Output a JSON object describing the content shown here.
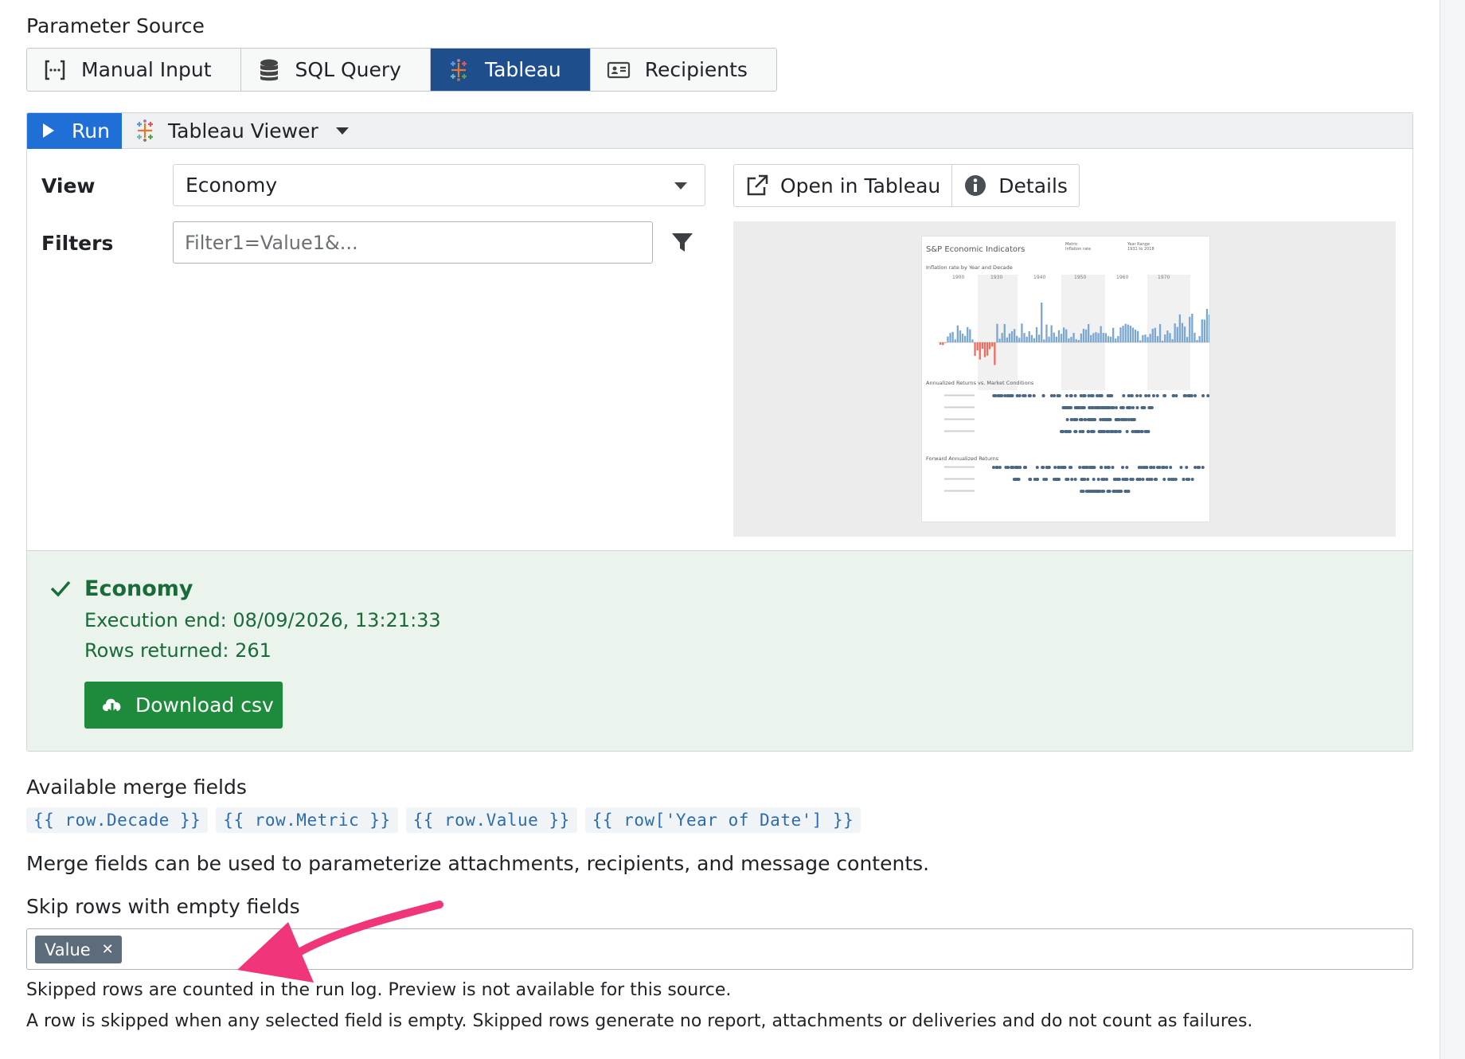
{
  "parameter_source": {
    "label": "Parameter Source",
    "tabs": [
      {
        "label": "Manual Input",
        "icon": "bracket-dots-icon",
        "active": false
      },
      {
        "label": "SQL Query",
        "icon": "database-icon",
        "active": false
      },
      {
        "label": "Tableau",
        "icon": "tableau-icon",
        "active": true
      },
      {
        "label": "Recipients",
        "icon": "id-card-icon",
        "active": false
      }
    ]
  },
  "toolbar": {
    "run_label": "Run",
    "viewer_label": "Tableau Viewer"
  },
  "form": {
    "view_label": "View",
    "view_value": "Economy",
    "filters_label": "Filters",
    "filters_placeholder": "Filter1=Value1&..."
  },
  "actions": {
    "open_label": "Open in Tableau",
    "details_label": "Details"
  },
  "preview": {
    "title": "S&P Economic Indicators",
    "section1": "Inflation rate by Year and Decade",
    "section2": "Annualized Returns vs. Market Conditions",
    "section3": "Forward Annualized Returns",
    "decades": [
      "1900",
      "1930",
      "1940",
      "1950",
      "1960",
      "1970"
    ],
    "header_metric_label": "Metric",
    "header_metric_value": "Inflation rate",
    "header_range_label": "Year Range",
    "header_range_value": "1931 to 2018"
  },
  "result": {
    "title": "Economy",
    "execution_end": "Execution end: 08/09/2026, 13:21:33",
    "rows_returned": "Rows returned: 261",
    "download_label": "Download csv"
  },
  "merge": {
    "label": "Available merge fields",
    "fields": [
      "{{ row.Decade }}",
      "{{ row.Metric }}",
      "{{ row.Value }}",
      "{{ row['Year of Date'] }}"
    ],
    "help": "Merge fields can be used to parameterize attachments, recipients, and message contents."
  },
  "skip": {
    "label": "Skip rows with empty fields",
    "tags": [
      "Value"
    ],
    "note1": "Skipped rows are counted in the run log. Preview is not available for this source.",
    "note2": "A row is skipped when any selected field is empty. Skipped rows generate no report, attachments or deliveries and do not count as failures."
  },
  "colors": {
    "accent": "#1f4e8c",
    "run": "#1f6fd6",
    "success": "#1a6b3a",
    "download": "#1e8a3c",
    "annotation_arrow": "#f0357a"
  }
}
